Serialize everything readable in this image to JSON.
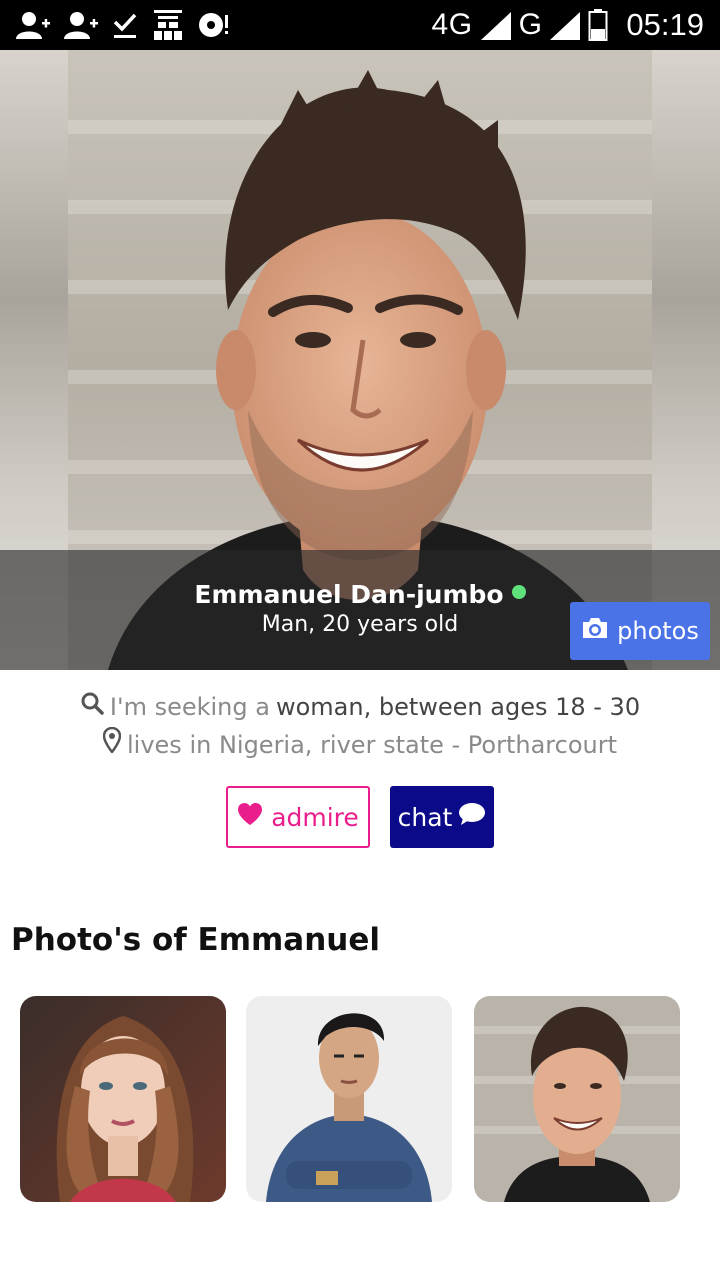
{
  "status_bar": {
    "icons_left": [
      "add-person-icon",
      "add-person-icon",
      "download-done-icon",
      "news-icon",
      "disc-alert-icon"
    ],
    "network_label": "4G",
    "network_small": "4G",
    "carrier_label": "G",
    "time": "05:19"
  },
  "profile": {
    "name": "Emmanuel Dan-jumbo",
    "online_color": "#5fe07a",
    "subtitle": "Man, 20 years old",
    "photos_button": "photos",
    "seeking_prefix": "I'm seeking a",
    "seeking_value": "woman, between ages 18 - 30",
    "lives_text": "lives in Nigeria, river state - Portharcourt",
    "admire_button": "admire",
    "chat_button": "chat"
  },
  "gallery": {
    "title": "Photo's of Emmanuel",
    "thumbs": [
      "woman-portrait",
      "man-denim-shirt",
      "emmanuel-smiling"
    ]
  },
  "colors": {
    "accent_blue": "#4a73e8",
    "admire_pink": "#e91e8c",
    "chat_navy": "#0b0b8a"
  }
}
